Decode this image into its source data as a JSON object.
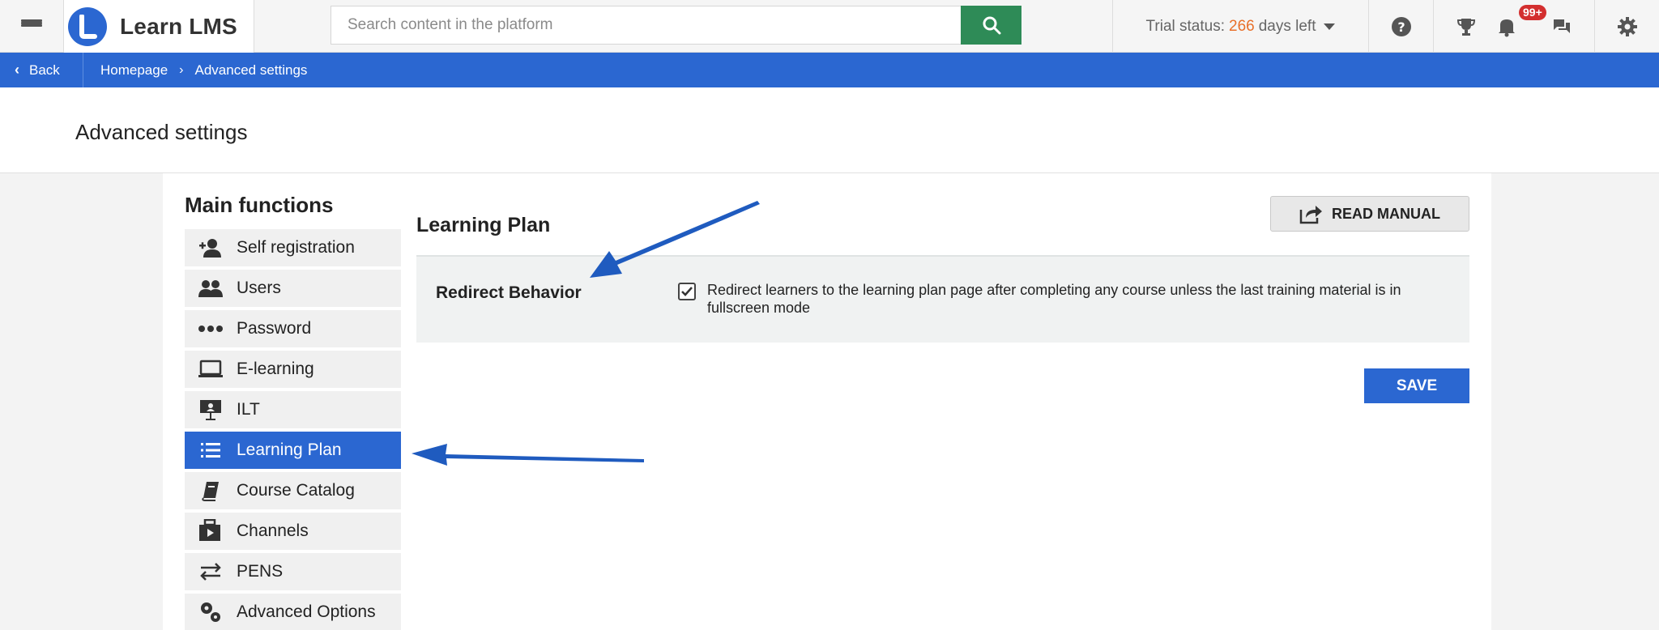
{
  "header": {
    "brand": "Learn LMS",
    "search_placeholder": "Search content in the platform",
    "trial_prefix": "Trial status:",
    "trial_days": "266",
    "trial_suffix": "days left",
    "notification_badge": "99+",
    "icons": [
      "menu-icon",
      "help-icon",
      "trophy-icon",
      "bell-icon",
      "chat-icon",
      "gear-icon"
    ]
  },
  "breadcrumb": {
    "back_label": "Back",
    "items": [
      "Homepage",
      "Advanced settings"
    ]
  },
  "page": {
    "title": "Advanced settings"
  },
  "sidebar": {
    "heading": "Main functions",
    "items": [
      {
        "label": "Self registration",
        "icon": "add-user-icon",
        "active": false
      },
      {
        "label": "Users",
        "icon": "users-icon",
        "active": false
      },
      {
        "label": "Password",
        "icon": "dots-icon",
        "active": false
      },
      {
        "label": "E-learning",
        "icon": "laptop-icon",
        "active": false
      },
      {
        "label": "ILT",
        "icon": "presentation-icon",
        "active": false
      },
      {
        "label": "Learning Plan",
        "icon": "list-icon",
        "active": true
      },
      {
        "label": "Course Catalog",
        "icon": "book-icon",
        "active": false
      },
      {
        "label": "Channels",
        "icon": "channels-icon",
        "active": false
      },
      {
        "label": "PENS",
        "icon": "swap-icon",
        "active": false
      },
      {
        "label": "Advanced Options",
        "icon": "gears-icon",
        "active": false
      }
    ]
  },
  "main": {
    "section_title": "Learning Plan",
    "manual_label": "READ MANUAL",
    "setting": {
      "label": "Redirect Behavior",
      "checked": true,
      "description": "Redirect learners to the learning plan page after completing any course unless the last training material is in fullscreen mode"
    },
    "save_label": "SAVE"
  },
  "colors": {
    "accent": "#2b67d1",
    "search_button": "#2e8b57",
    "trial_days": "#e8702a",
    "badge": "#d32f2f"
  }
}
